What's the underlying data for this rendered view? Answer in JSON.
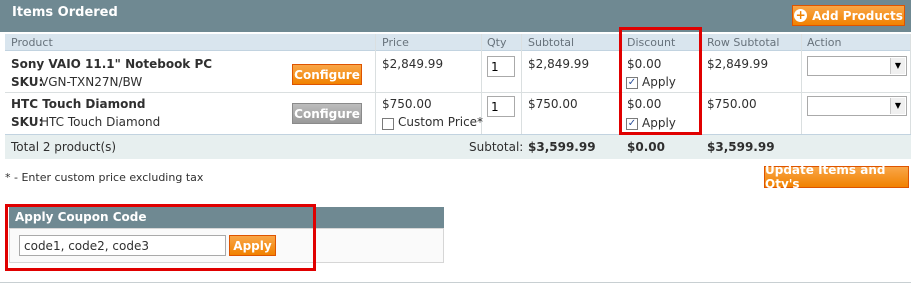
{
  "header": {
    "title": "Items Ordered",
    "add_products_label": "Add Products"
  },
  "columns": [
    "Product",
    "Price",
    "Qty",
    "Subtotal",
    "Discount",
    "Row Subtotal",
    "Action"
  ],
  "items": [
    {
      "name": "Sony VAIO 11.1\" Notebook PC",
      "sku_label": "SKU:",
      "sku": "VGN-TXN27N/BW",
      "configure_label": "Configure",
      "price": "$2,849.99",
      "qty": "1",
      "subtotal": "$2,849.99",
      "discount": "$0.00",
      "apply_label": "Apply",
      "apply_checked": true,
      "row_subtotal": "$2,849.99",
      "action_value": ""
    },
    {
      "name": "HTC Touch Diamond",
      "sku_label": "SKU:",
      "sku": "HTC Touch Diamond",
      "configure_label": "Configure",
      "price": "$750.00",
      "custom_price_label": "Custom Price*",
      "qty": "1",
      "subtotal": "$750.00",
      "discount": "$0.00",
      "apply_label": "Apply",
      "apply_checked": true,
      "row_subtotal": "$750.00",
      "action_value": ""
    }
  ],
  "totals": {
    "label": "Total 2 product(s)",
    "subtotal_label": "Subtotal:",
    "subtotal": "$3,599.99",
    "discount": "$0.00",
    "row_subtotal": "$3,599.99"
  },
  "footnote": "* - Enter custom price excluding tax",
  "update_label": "Update Items and Qty's",
  "coupon": {
    "title": "Apply Coupon Code",
    "value": "code1, code2, code3",
    "apply_label": "Apply"
  },
  "colors": {
    "accent": "#f18200",
    "header": "#6f8992",
    "highlight": "#e00000"
  }
}
